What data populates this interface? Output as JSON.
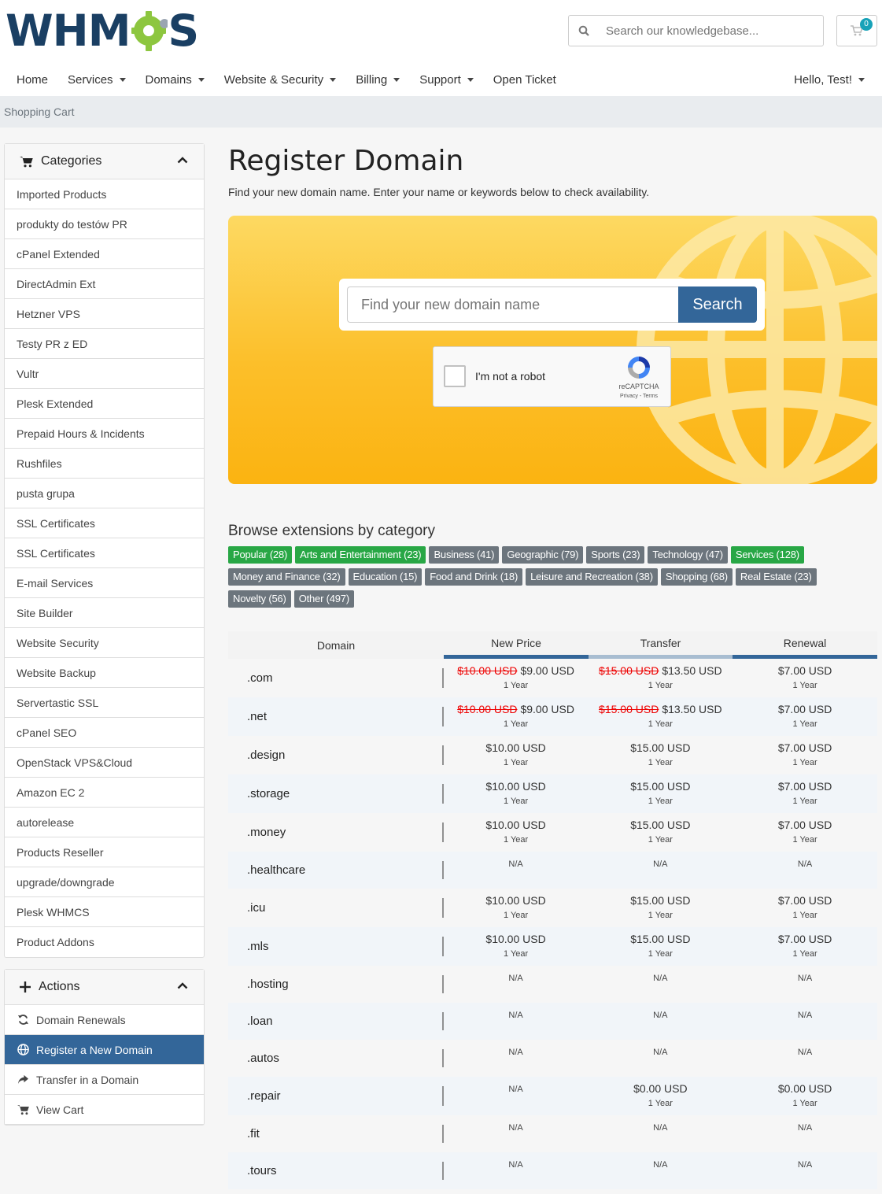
{
  "header": {
    "logo_text_left": "WHM",
    "logo_text_right": "S",
    "search_placeholder": "Search our knowledgebase...",
    "cart_count": "0"
  },
  "nav": {
    "items": [
      {
        "label": "Home",
        "dropdown": false
      },
      {
        "label": "Services",
        "dropdown": true
      },
      {
        "label": "Domains",
        "dropdown": true
      },
      {
        "label": "Website & Security",
        "dropdown": true
      },
      {
        "label": "Billing",
        "dropdown": true
      },
      {
        "label": "Support",
        "dropdown": true
      },
      {
        "label": "Open Ticket",
        "dropdown": false
      }
    ],
    "user": "Hello, Test!"
  },
  "breadcrumb": "Shopping Cart",
  "sidebar": {
    "categories_title": "Categories",
    "categories": [
      "Imported Products",
      "produkty do testów PR",
      "cPanel Extended",
      "DirectAdmin Ext",
      "Hetzner VPS",
      "Testy PR z ED",
      "Vultr",
      "Plesk Extended",
      "Prepaid Hours & Incidents",
      "Rushfiles",
      "pusta grupa",
      "SSL Certificates",
      "SSL Certificates",
      "E-mail Services",
      "Site Builder",
      "Website Security",
      "Website Backup",
      "Servertastic SSL",
      "cPanel SEO",
      "OpenStack VPS&Cloud",
      "Amazon EC 2",
      "autorelease",
      "Products Reseller",
      "upgrade/downgrade",
      "Plesk WHMCS",
      "Product Addons"
    ],
    "actions_title": "Actions",
    "actions": [
      {
        "label": "Domain Renewals",
        "icon": "sync-icon",
        "active": false
      },
      {
        "label": "Register a New Domain",
        "icon": "globe-icon",
        "active": true
      },
      {
        "label": "Transfer in a Domain",
        "icon": "share-arrow-icon",
        "active": false
      },
      {
        "label": "View Cart",
        "icon": "cart-icon",
        "active": false
      }
    ]
  },
  "main": {
    "title": "Register Domain",
    "subtitle": "Find your new domain name. Enter your name or keywords below to check availability.",
    "domain_placeholder": "Find your new domain name",
    "search_button": "Search",
    "recaptcha": {
      "label": "I'm not a robot",
      "brand": "reCAPTCHA",
      "links": "Privacy - Terms"
    },
    "browse_title": "Browse extensions by category",
    "tag_rows": [
      [
        {
          "label": "Popular (28)",
          "green": true
        },
        {
          "label": "Arts and Entertainment (23)",
          "green": true
        },
        {
          "label": "Business (41)",
          "green": false
        },
        {
          "label": "Geographic (79)",
          "green": false
        },
        {
          "label": "Sports (23)",
          "green": false
        },
        {
          "label": "Technology (47)",
          "green": false
        },
        {
          "label": "Services (128)",
          "green": true
        }
      ],
      [
        {
          "label": "Money and Finance (32)",
          "green": false
        },
        {
          "label": "Education (15)",
          "green": false
        },
        {
          "label": "Food and Drink (18)",
          "green": false
        },
        {
          "label": "Leisure and Recreation (38)",
          "green": false
        },
        {
          "label": "Shopping (68)",
          "green": false
        },
        {
          "label": "Real Estate (23)",
          "green": false
        }
      ],
      [
        {
          "label": "Novelty (56)",
          "green": false
        },
        {
          "label": "Other (497)",
          "green": false
        }
      ]
    ],
    "table": {
      "headers": [
        "Domain",
        "New Price",
        "Transfer",
        "Renewal"
      ],
      "rows": [
        {
          "tld": ".com",
          "new": {
            "old": "$10.00 USD",
            "price": "$9.00 USD",
            "term": "1 Year"
          },
          "transfer": {
            "old": "$15.00 USD",
            "price": "$13.50 USD",
            "term": "1 Year"
          },
          "renewal": {
            "price": "$7.00 USD",
            "term": "1 Year"
          }
        },
        {
          "tld": ".net",
          "new": {
            "old": "$10.00 USD",
            "price": "$9.00 USD",
            "term": "1 Year"
          },
          "transfer": {
            "old": "$15.00 USD",
            "price": "$13.50 USD",
            "term": "1 Year"
          },
          "renewal": {
            "price": "$7.00 USD",
            "term": "1 Year"
          }
        },
        {
          "tld": ".design",
          "new": {
            "price": "$10.00 USD",
            "term": "1 Year"
          },
          "transfer": {
            "price": "$15.00 USD",
            "term": "1 Year"
          },
          "renewal": {
            "price": "$7.00 USD",
            "term": "1 Year"
          }
        },
        {
          "tld": ".storage",
          "new": {
            "price": "$10.00 USD",
            "term": "1 Year"
          },
          "transfer": {
            "price": "$15.00 USD",
            "term": "1 Year"
          },
          "renewal": {
            "price": "$7.00 USD",
            "term": "1 Year"
          }
        },
        {
          "tld": ".money",
          "new": {
            "price": "$10.00 USD",
            "term": "1 Year"
          },
          "transfer": {
            "price": "$15.00 USD",
            "term": "1 Year"
          },
          "renewal": {
            "price": "$7.00 USD",
            "term": "1 Year"
          }
        },
        {
          "tld": ".healthcare",
          "new": {
            "na": "N/A"
          },
          "transfer": {
            "na": "N/A"
          },
          "renewal": {
            "na": "N/A"
          }
        },
        {
          "tld": ".icu",
          "new": {
            "price": "$10.00 USD",
            "term": "1 Year"
          },
          "transfer": {
            "price": "$15.00 USD",
            "term": "1 Year"
          },
          "renewal": {
            "price": "$7.00 USD",
            "term": "1 Year"
          }
        },
        {
          "tld": ".mls",
          "new": {
            "price": "$10.00 USD",
            "term": "1 Year"
          },
          "transfer": {
            "price": "$15.00 USD",
            "term": "1 Year"
          },
          "renewal": {
            "price": "$7.00 USD",
            "term": "1 Year"
          }
        },
        {
          "tld": ".hosting",
          "new": {
            "na": "N/A"
          },
          "transfer": {
            "na": "N/A"
          },
          "renewal": {
            "na": "N/A"
          }
        },
        {
          "tld": ".loan",
          "new": {
            "na": "N/A"
          },
          "transfer": {
            "na": "N/A"
          },
          "renewal": {
            "na": "N/A"
          }
        },
        {
          "tld": ".autos",
          "new": {
            "na": "N/A"
          },
          "transfer": {
            "na": "N/A"
          },
          "renewal": {
            "na": "N/A"
          }
        },
        {
          "tld": ".repair",
          "new": {
            "na": "N/A"
          },
          "transfer": {
            "price": "$0.00 USD",
            "term": "1 Year"
          },
          "renewal": {
            "price": "$0.00 USD",
            "term": "1 Year"
          }
        },
        {
          "tld": ".fit",
          "new": {
            "na": "N/A"
          },
          "transfer": {
            "na": "N/A"
          },
          "renewal": {
            "na": "N/A"
          }
        },
        {
          "tld": ".tours",
          "new": {
            "na": "N/A"
          },
          "transfer": {
            "na": "N/A"
          },
          "renewal": {
            "na": "N/A"
          }
        }
      ]
    }
  },
  "colors": {
    "primary": "#336699",
    "green_tag": "#28a745",
    "gray_tag": "#6c757d",
    "hero_yellow": "#fcbf2a",
    "badge": "#17a2b8"
  }
}
